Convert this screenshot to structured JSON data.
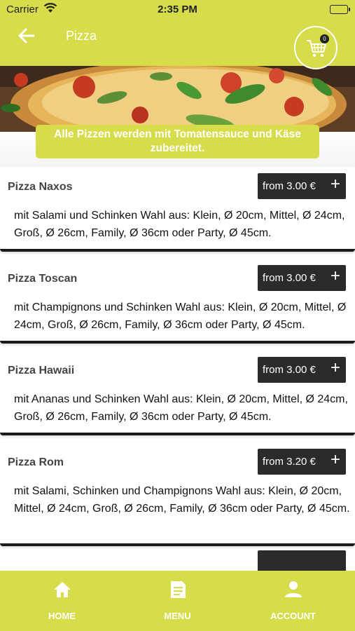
{
  "status_bar": {
    "carrier": "Carrier",
    "time": "2:35 PM"
  },
  "header": {
    "title": "Pizza",
    "cart_count": "0"
  },
  "notice": "Alle Pizzen werden mit Tomatensauce und Käse zubereitet.",
  "products": [
    {
      "name": "Pizza Naxos",
      "price": "from 3.00 €",
      "description": "mit Salami und Schinken  Wahl aus: Klein, Ø 20cm, Mittel, Ø 24cm, Groß, Ø 26cm, Family, Ø 36cm oder Party, Ø 45cm."
    },
    {
      "name": "Pizza Toscan",
      "price": "from 3.00 €",
      "description": "mit Champignons und Schinken  Wahl aus: Klein, Ø 20cm, Mittel, Ø 24cm, Groß, Ø 26cm, Family, Ø 36cm oder Party, Ø 45cm."
    },
    {
      "name": "Pizza Hawaii",
      "price": "from 3.00 €",
      "description": "mit Ananas und Schinken  Wahl aus: Klein, Ø 20cm, Mittel, Ø 24cm, Groß, Ø 26cm, Family, Ø 36cm oder Party, Ø 45cm."
    },
    {
      "name": "Pizza Rom",
      "price": "from 3.20 €",
      "description": "mit Salami, Schinken und Champignons  Wahl aus: Klein, Ø 20cm, Mittel, Ø 24cm, Groß, Ø 26cm, Family, Ø 36cm oder Party, Ø 45cm."
    }
  ],
  "add_symbol": "+",
  "bottom_nav": [
    {
      "label": "HOME",
      "icon": "home-icon"
    },
    {
      "label": "MENU",
      "icon": "menu-icon"
    },
    {
      "label": "ACCOUNT",
      "icon": "account-icon"
    }
  ],
  "colors": {
    "accent": "#d6dc4a",
    "button_dark": "#2b2b2b"
  }
}
